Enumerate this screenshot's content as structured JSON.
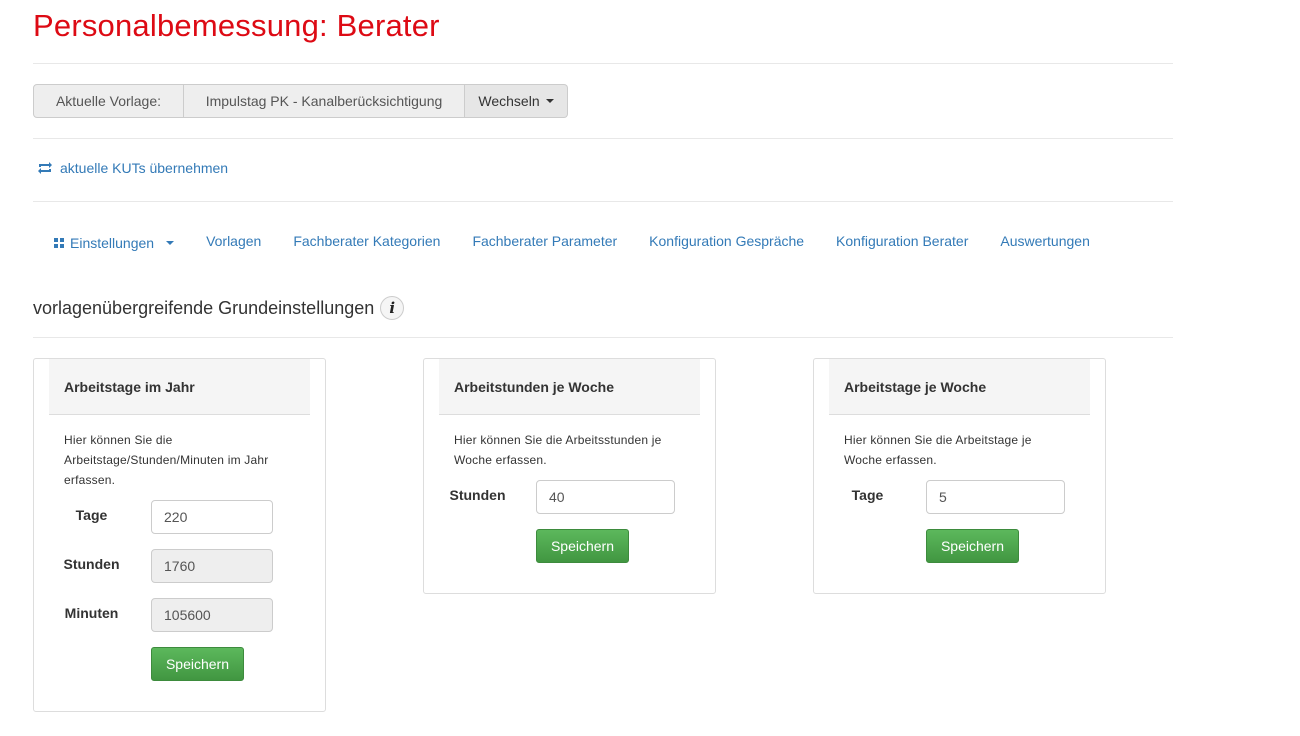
{
  "page": {
    "title": "Personalbemessung: Berater"
  },
  "vorlage": {
    "label": "Aktuelle Vorlage:",
    "value": "Impulstag PK - Kanalberücksichtigung",
    "switch_label": "Wechseln"
  },
  "kut_link": {
    "label": "aktuelle KUTs übernehmen",
    "icon": "retweet-icon"
  },
  "nav": {
    "settings": {
      "label": "Einstellungen",
      "icon": "grid-icon"
    },
    "items": [
      {
        "label": "Vorlagen"
      },
      {
        "label": "Fachberater Kategorien"
      },
      {
        "label": "Fachberater Parameter"
      },
      {
        "label": "Konfiguration Gespräche"
      },
      {
        "label": "Konfiguration Berater"
      },
      {
        "label": "Auswertungen"
      }
    ]
  },
  "section": {
    "title": "vorlagenübergreifende Grundeinstellungen",
    "info_icon": "i"
  },
  "panels": {
    "year": {
      "title": "Arbeitstage im Jahr",
      "description": "Hier können Sie die Arbeitstage/Stunden/Minuten im Jahr erfassen.",
      "days_label": "Tage",
      "days_value": "220",
      "hours_label": "Stunden",
      "hours_value": "1760",
      "minutes_label": "Minuten",
      "minutes_value": "105600",
      "save_label": "Speichern"
    },
    "hours_week": {
      "title": "Arbeitstunden je Woche",
      "description": "Hier können Sie die Arbeitsstunden je Woche erfassen.",
      "hours_label": "Stunden",
      "hours_value": "40",
      "save_label": "Speichern"
    },
    "days_week": {
      "title": "Arbeitstage je Woche",
      "description": "Hier können Sie die Arbeitstage je Woche erfassen.",
      "days_label": "Tage",
      "days_value": "5",
      "save_label": "Speichern"
    }
  },
  "colors": {
    "title_red": "#dd0a14",
    "link_blue": "#337ab7",
    "save_green": "#46a748"
  }
}
